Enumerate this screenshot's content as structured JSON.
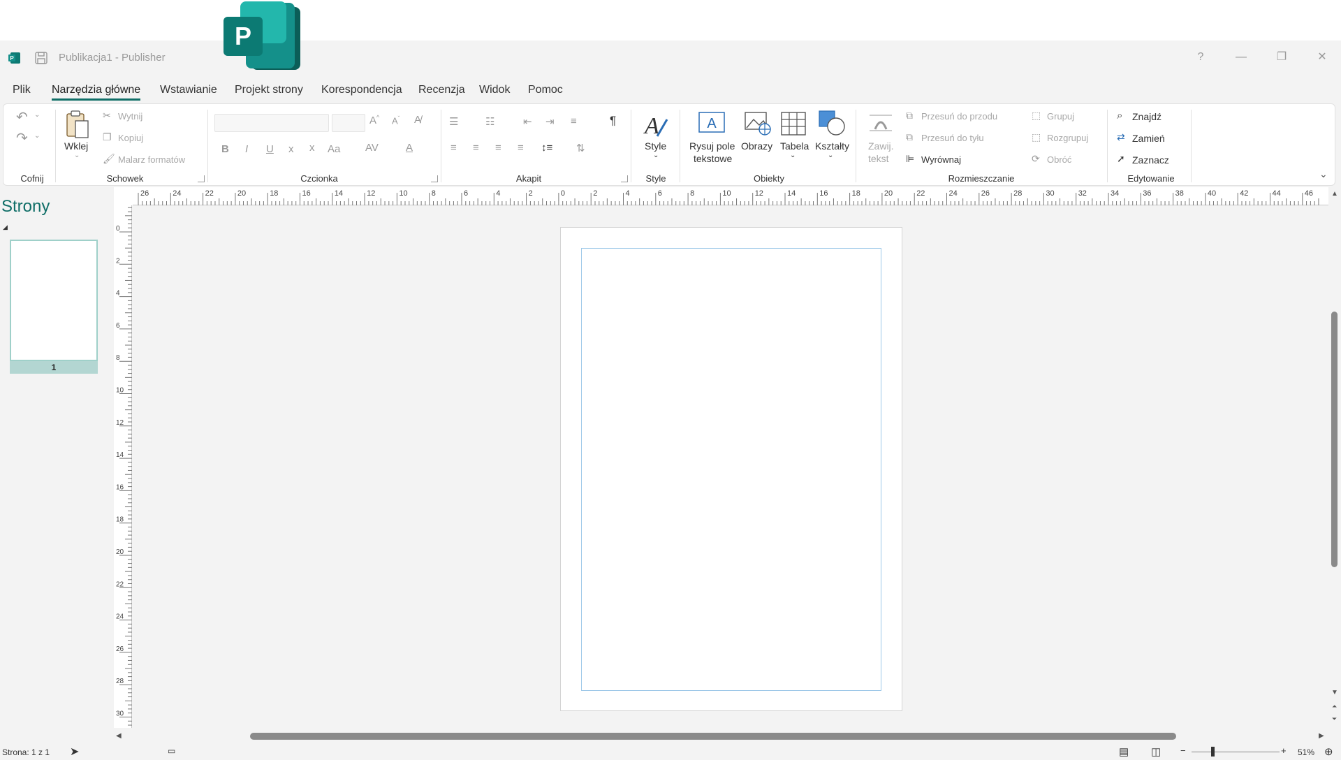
{
  "window": {
    "title": "Publikacja1  -  Publisher"
  },
  "tabs": [
    "Plik",
    "Narzędzia główne",
    "Wstawianie",
    "Projekt strony",
    "Korespondencja",
    "Recenzja",
    "Widok",
    "Pomoc"
  ],
  "ribbon": {
    "groups": {
      "undo": "Cofnij",
      "clipboard": "Schowek",
      "font": "Czcionka",
      "paragraph": "Akapit",
      "styles": "Style",
      "objects": "Obiekty",
      "arrange": "Rozmieszczanie",
      "editing": "Edytowanie"
    },
    "clipboard": {
      "paste": "Wklej",
      "cut": "Wytnij",
      "copy": "Kopiuj",
      "format_painter": "Malarz formatów"
    },
    "styles": {
      "style": "Style"
    },
    "objects": {
      "draw_textbox_1": "Rysuj pole",
      "draw_textbox_2": "tekstowe",
      "pictures": "Obrazy",
      "table": "Tabela",
      "shapes": "Kształty"
    },
    "arrange": {
      "wrap_1": "Zawij.",
      "wrap_2": "tekst",
      "bring_forward": "Przesuń do przodu",
      "send_backward": "Przesuń do tyłu",
      "align": "Wyrównaj",
      "group": "Grupuj",
      "ungroup": "Rozgrupuj",
      "rotate": "Obróć"
    },
    "editing": {
      "find": "Znajdź",
      "replace": "Zamień",
      "select": "Zaznacz"
    },
    "font_buttons": {
      "bold": "B",
      "italic": "I",
      "underline": "U",
      "subscript": "x",
      "superscript": "x",
      "case": "Aa",
      "spacing": "AV",
      "color": "A"
    }
  },
  "pages_panel": {
    "title": "Strony",
    "thumb_number": "1"
  },
  "ruler": {
    "h_labels": [
      "26",
      "24",
      "22",
      "20",
      "18",
      "16",
      "14",
      "12",
      "10",
      "8",
      "6",
      "4",
      "2",
      "0",
      "2",
      "4",
      "6",
      "8",
      "10",
      "12",
      "14",
      "16",
      "18",
      "20",
      "22",
      "24",
      "26",
      "28",
      "30",
      "32",
      "34",
      "36",
      "38",
      "40",
      "42",
      "44",
      "46"
    ],
    "v_labels": [
      "0",
      "2",
      "4",
      "6",
      "8",
      "10",
      "12",
      "14",
      "16",
      "18",
      "20",
      "22",
      "24",
      "26",
      "28",
      "30"
    ]
  },
  "status": {
    "page": "Strona: 1 z 1",
    "zoom": "51%"
  },
  "colors": {
    "accent": "#0f6e67",
    "page_margin": "#9dc8e8"
  }
}
